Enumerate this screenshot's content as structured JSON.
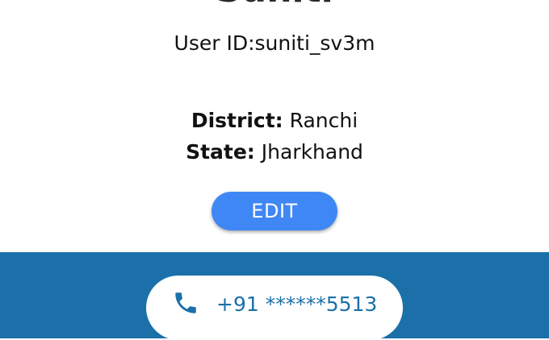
{
  "profile": {
    "name": "Suniti",
    "user_id_text": "User ID:suniti_sv3m",
    "district_label": "District:",
    "district_value": "Ranchi",
    "state_label": "State:",
    "state_value": "Jharkhand",
    "edit_label": "EDIT"
  },
  "contact": {
    "phone_icon": "phone-icon",
    "phone_number": "+91 ******5513"
  },
  "colors": {
    "accent_button": "#3f87f5",
    "band_background": "#1b70aa",
    "phone_text": "#1b70aa"
  }
}
